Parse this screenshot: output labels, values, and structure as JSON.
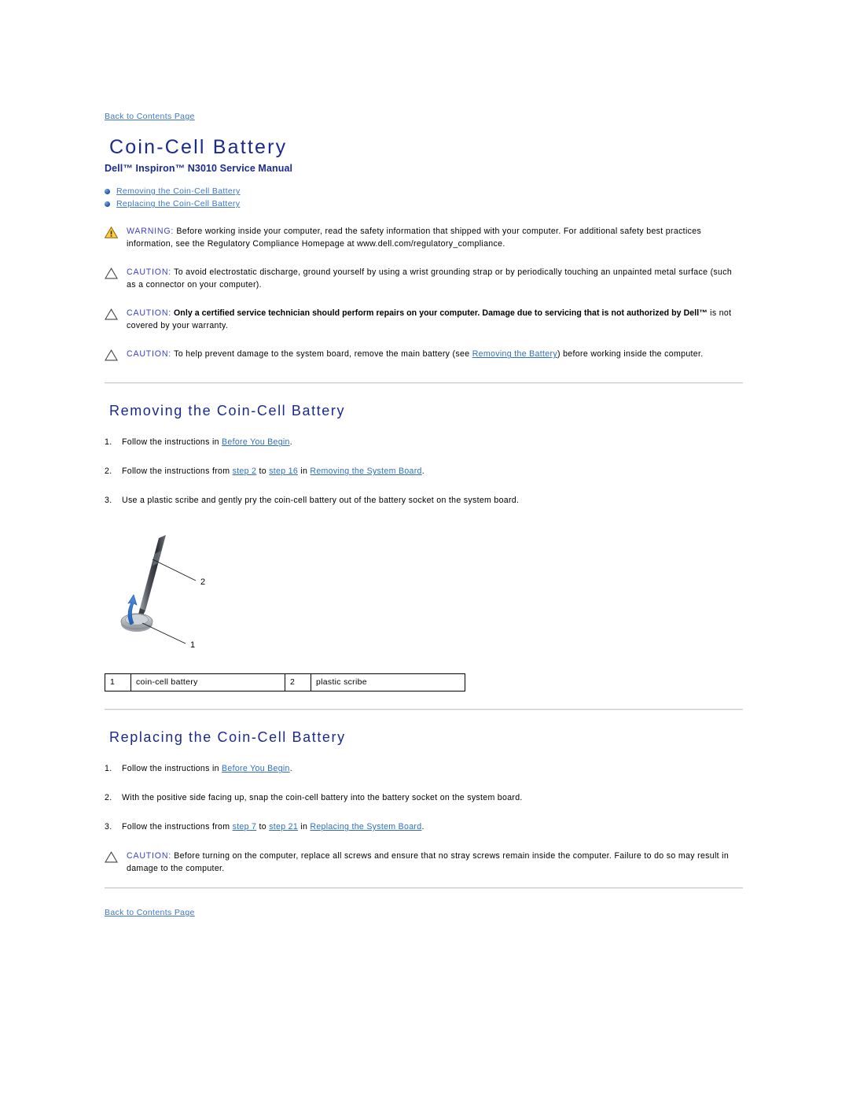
{
  "header": {
    "back_to_contents": "Back to Contents Page",
    "title": "Coin-Cell Battery",
    "subtitle": "Dell™ Inspiron™ N3010 Service Manual"
  },
  "toc": {
    "items": [
      {
        "label": "Removing the Coin-Cell Battery"
      },
      {
        "label": "Replacing the Coin-Cell Battery"
      }
    ]
  },
  "notices": [
    {
      "icon": "warning-triangle-icon",
      "lead": "WARNING:",
      "bold": false,
      "text": " Before working inside your computer, read the safety information that shipped with your computer. For additional safety best practices information, see the Regulatory Compliance Homepage at www.dell.com/regulatory_compliance."
    },
    {
      "icon": "caution-triangle-icon",
      "lead": "CAUTION:",
      "bold": false,
      "text": " To avoid electrostatic discharge, ground yourself by using a wrist grounding strap or by periodically touching an unpainted metal surface (such as a connector on your computer)."
    },
    {
      "icon": "caution-triangle-icon",
      "lead": "CAUTION:",
      "bold": true,
      "bold_text": " Only a certified service technician should perform repairs on your computer. Damage due to servicing that is not authorized by Dell™",
      "text": " is not covered by your warranty."
    },
    {
      "icon": "caution-triangle-icon",
      "lead": "CAUTION:",
      "bold": false,
      "text_before": " To help prevent damage to the system board, remove the main battery (see ",
      "link": "Removing the Battery",
      "text_after": ") before working inside the computer."
    }
  ],
  "removing": {
    "heading": "Removing the Coin-Cell Battery",
    "steps": [
      {
        "num": "1.",
        "before": "Follow the instructions in ",
        "link1": "Before You Begin",
        "after": "."
      },
      {
        "num": "2.",
        "before": "Follow the instructions from ",
        "link1": "step 2",
        "mid1": " to ",
        "link2": "step 16",
        "mid2": " in ",
        "link3": "Removing the System Board",
        "after": "."
      },
      {
        "num": "3.",
        "before": "Use a plastic scribe and gently pry the coin-cell battery out of the battery socket on the system board.",
        "after": ""
      }
    ],
    "figure": {
      "callout_1": "1",
      "callout_2": "2",
      "alt": "coin-cell battery being pried out with a plastic scribe"
    },
    "callout_table": {
      "rows": [
        {
          "n1": "1",
          "l1": "coin-cell battery",
          "n2": "2",
          "l2": "plastic scribe"
        }
      ]
    }
  },
  "replacing": {
    "heading": "Replacing the Coin-Cell Battery",
    "steps": [
      {
        "num": "1.",
        "before": "Follow the instructions in ",
        "link1": "Before You Begin",
        "after": "."
      },
      {
        "num": "2.",
        "before": "With the positive side facing up, snap the coin-cell battery into the battery socket on the system board.",
        "after": ""
      },
      {
        "num": "3.",
        "before": "Follow the instructions from ",
        "link1": "step 7",
        "mid1": " to ",
        "link2": "step 21",
        "mid2": " in ",
        "link3": "Replacing the System Board",
        "after": "."
      }
    ]
  },
  "final_notice": {
    "icon": "caution-triangle-icon",
    "lead": "CAUTION:",
    "text": " Before turning on the computer, replace all screws and ensure that no stray screws remain inside the computer. Failure to do so may result in damage to the computer."
  },
  "footer": {
    "back_to_contents": "Back to Contents Page"
  },
  "colors": {
    "heading_blue": "#1b2a8e",
    "link_blue": "#2f6fbd",
    "notice_lead_blue": "#3b41c8",
    "warning_yellow": "#ffcc33",
    "rule_gray": "#c8cace"
  }
}
